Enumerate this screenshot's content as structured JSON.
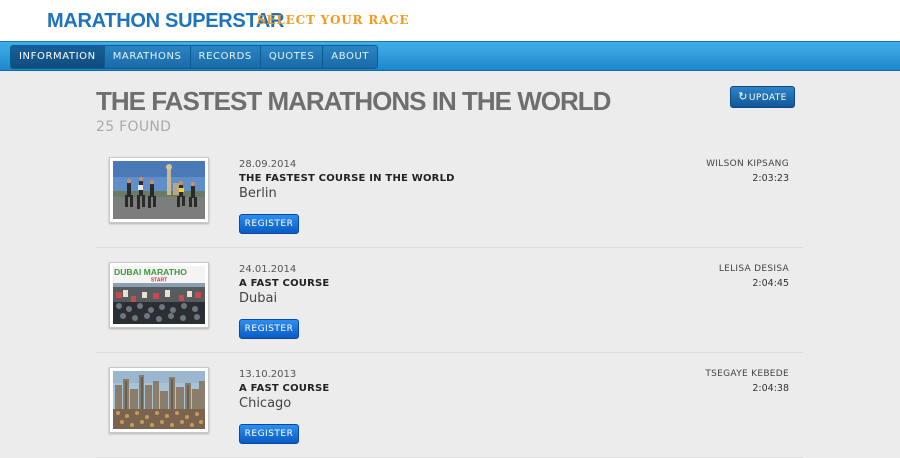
{
  "header": {
    "brand": "MARATHON SUPERSTAR",
    "tagline": "SELECT YOUR RACE"
  },
  "nav": {
    "items": [
      {
        "label": "INFORMATION",
        "active": true
      },
      {
        "label": "MARATHONS",
        "active": false
      },
      {
        "label": "RECORDS",
        "active": false
      },
      {
        "label": "QUOTES",
        "active": false
      },
      {
        "label": "ABOUT",
        "active": false
      }
    ]
  },
  "main": {
    "title": "THE FASTEST MARATHONS IN THE WORLD",
    "count_text": "25 FOUND",
    "update_label": "UPDATE",
    "update_icon": "refresh-icon"
  },
  "races": [
    {
      "date": "28.09.2014",
      "headline": "THE FASTEST COURSE IN THE WORLD",
      "city": "Berlin",
      "register_label": "REGISTER",
      "runner": "WILSON KIPSANG",
      "time": "2:03:23",
      "image": "berlin-runners-photo"
    },
    {
      "date": "24.01.2014",
      "headline": "A FAST COURSE",
      "city": "Dubai",
      "register_label": "REGISTER",
      "runner": "LELISA DESISA",
      "time": "2:04:45",
      "image": "dubai-start-photo",
      "image_banner": "DUBAI MARATHO",
      "image_banner_sub": "START"
    },
    {
      "date": "13.10.2013",
      "headline": "A FAST COURSE",
      "city": "Chicago",
      "register_label": "REGISTER",
      "runner": "TSEGAYE KEBEDE",
      "time": "2:04:38",
      "image": "chicago-skyline-photo"
    }
  ],
  "colors": {
    "brand": "#1e73be",
    "tagline": "#f39a1e",
    "navbar": "#2a9ae0",
    "register_button": "#1670dd",
    "update_button": "#1a69ad"
  }
}
